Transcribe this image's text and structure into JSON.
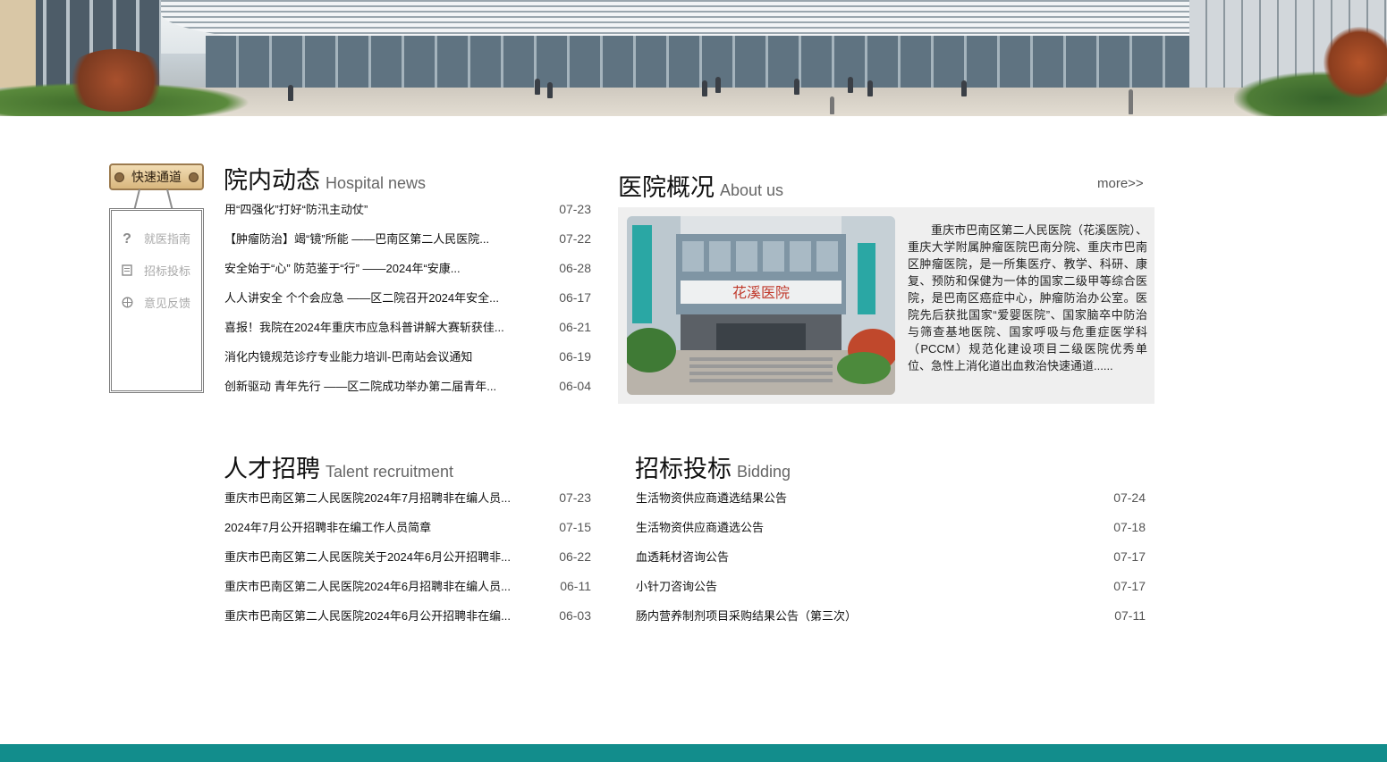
{
  "quick_channel": {
    "title": "快速通道",
    "items": [
      {
        "label": "就医指南",
        "icon": "question-icon"
      },
      {
        "label": "招标投标",
        "icon": "document-icon"
      },
      {
        "label": "意见反馈",
        "icon": "feedback-icon"
      }
    ]
  },
  "hospital_news": {
    "title_cn": "院内动态",
    "title_en": "Hospital news",
    "items": [
      {
        "title": "用“四强化”打好“防汛主动仗”",
        "date": "07-23"
      },
      {
        "title": "【肿瘤防治】竭“镜”所能 ——巴南区第二人民医院...",
        "date": "07-22"
      },
      {
        "title": "安全始于“心” 防范鉴于“行” ——2024年“安康...",
        "date": "06-28"
      },
      {
        "title": "人人讲安全 个个会应急 ——区二院召开2024年安全...",
        "date": "06-17"
      },
      {
        "title": "喜报！我院在2024年重庆市应急科普讲解大赛斩获佳...",
        "date": "06-21"
      },
      {
        "title": "消化内镜规范诊疗专业能力培训-巴南站会议通知",
        "date": "06-19"
      },
      {
        "title": "创新驱动 青年先行 ——区二院成功举办第二届青年...",
        "date": "06-04"
      }
    ]
  },
  "about": {
    "title_cn": "医院概况",
    "title_en": "About us",
    "more": "more>>",
    "photo_sign": "花溪医院",
    "text": "重庆市巴南区第二人民医院（花溪医院）、重庆大学附属肿瘤医院巴南分院、重庆市巴南区肿瘤医院，是一所集医疗、教学、科研、康复、预防和保健为一体的国家二级甲等综合医院，是巴南区癌症中心，肿瘤防治办公室。医院先后获批国家“爱婴医院”、国家脑卒中防治与筛查基地医院、国家呼吸与危重症医学科（PCCM）规范化建设项目二级医院优秀单位、急性上消化道出血救治快速通道......"
  },
  "recruitment": {
    "title_cn": "人才招聘",
    "title_en": "Talent recruitment",
    "items": [
      {
        "title": "重庆市巴南区第二人民医院2024年7月招聘非在编人员...",
        "date": "07-23"
      },
      {
        "title": "2024年7月公开招聘非在编工作人员简章",
        "date": "07-15"
      },
      {
        "title": "重庆市巴南区第二人民医院关于2024年6月公开招聘非...",
        "date": "06-22"
      },
      {
        "title": "重庆市巴南区第二人民医院2024年6月招聘非在编人员...",
        "date": "06-11"
      },
      {
        "title": "重庆市巴南区第二人民医院2024年6月公开招聘非在编...",
        "date": "06-03"
      }
    ]
  },
  "bidding": {
    "title_cn": "招标投标",
    "title_en": "Bidding",
    "items": [
      {
        "title": "生活物资供应商遴选结果公告",
        "date": "07-24"
      },
      {
        "title": "生活物资供应商遴选公告",
        "date": "07-18"
      },
      {
        "title": "血透耗材咨询公告",
        "date": "07-17"
      },
      {
        "title": "小针刀咨询公告",
        "date": "07-17"
      },
      {
        "title": "肠内营养制剂项目采购结果公告（第三次）",
        "date": "07-11"
      }
    ]
  },
  "colors": {
    "footer": "#128d8c",
    "about_bg": "#efefef",
    "sign_wood": "#d9b77e"
  }
}
